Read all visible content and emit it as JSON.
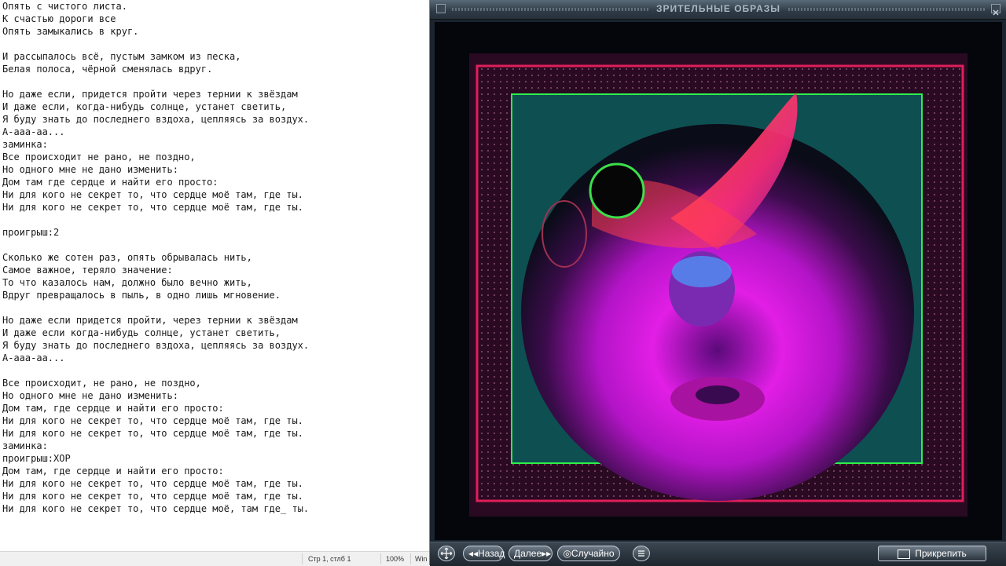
{
  "editor": {
    "text": "Опять с чистого листа.\nК счастью дороги все\nОпять замыкались в круг.\n\nИ рассыпалось всё, пустым замком из песка,\nБелая полоса, чёрной сменялась вдруг.\n\nНо даже если, придется пройти через тернии к звёздам\nИ даже если, когда-нибудь солнце, устанет светить,\nЯ буду знать до последнего вздоха, цепляясь за воздух.\nА-ааа-аа...\nзаминка:\nВсе происходит не рано, не поздно,\nНо одного мне не дано изменить:\nДом там где сердце и найти его просто:\nНи для кого не секрет то, что сердце моё там, где ты.\nНи для кого не секрет то, что сердце моё там, где ты.\n\nпроигрыш:2\n\nСколько же сотен раз, опять обрывалась нить,\nСамое важное, теряло значение:\nТо что казалось нам, должно было вечно жить,\nВдруг превращалось в пыль, в одно лишь мгновение.\n\nНо даже если придется пройти, через тернии к звёздам\nИ даже если когда-нибудь солнце, устанет светить,\nЯ буду знать до последнего вздоха, цепляясь за воздух.\nА-ааа-аа...\n\nВсе происходит, не рано, не поздно,\nНо одного мне не дано изменить:\nДом там, где сердце и найти его просто:\nНи для кого не секрет то, что сердце моё там, где ты.\nНи для кого не секрет то, что сердце моё там, где ты.\nзаминка:\nпроигрыш:ХОР\nДом там, где сердце и найти его просто:\nНи для кого не секрет то, что сердце моё там, где ты.\nНи для кого не секрет то, что сердце моё там, где ты.\nНи для кого не секрет то, что сердце моё, там где_ ты."
  },
  "statusbar": {
    "position": "Стр 1, стлб 1",
    "zoom": "100%",
    "encoding": "Win"
  },
  "visualizer": {
    "title": "ЗРИТЕЛЬНЫЕ ОБРАЗЫ",
    "back_label": "◂◂Назад",
    "next_label": "Далее▸▸",
    "random_label": "◎Случайно",
    "pin_label": "Прикрепить"
  },
  "icons": {
    "move": "move-icon",
    "options": "options-icon",
    "pin": "pin-icon"
  }
}
